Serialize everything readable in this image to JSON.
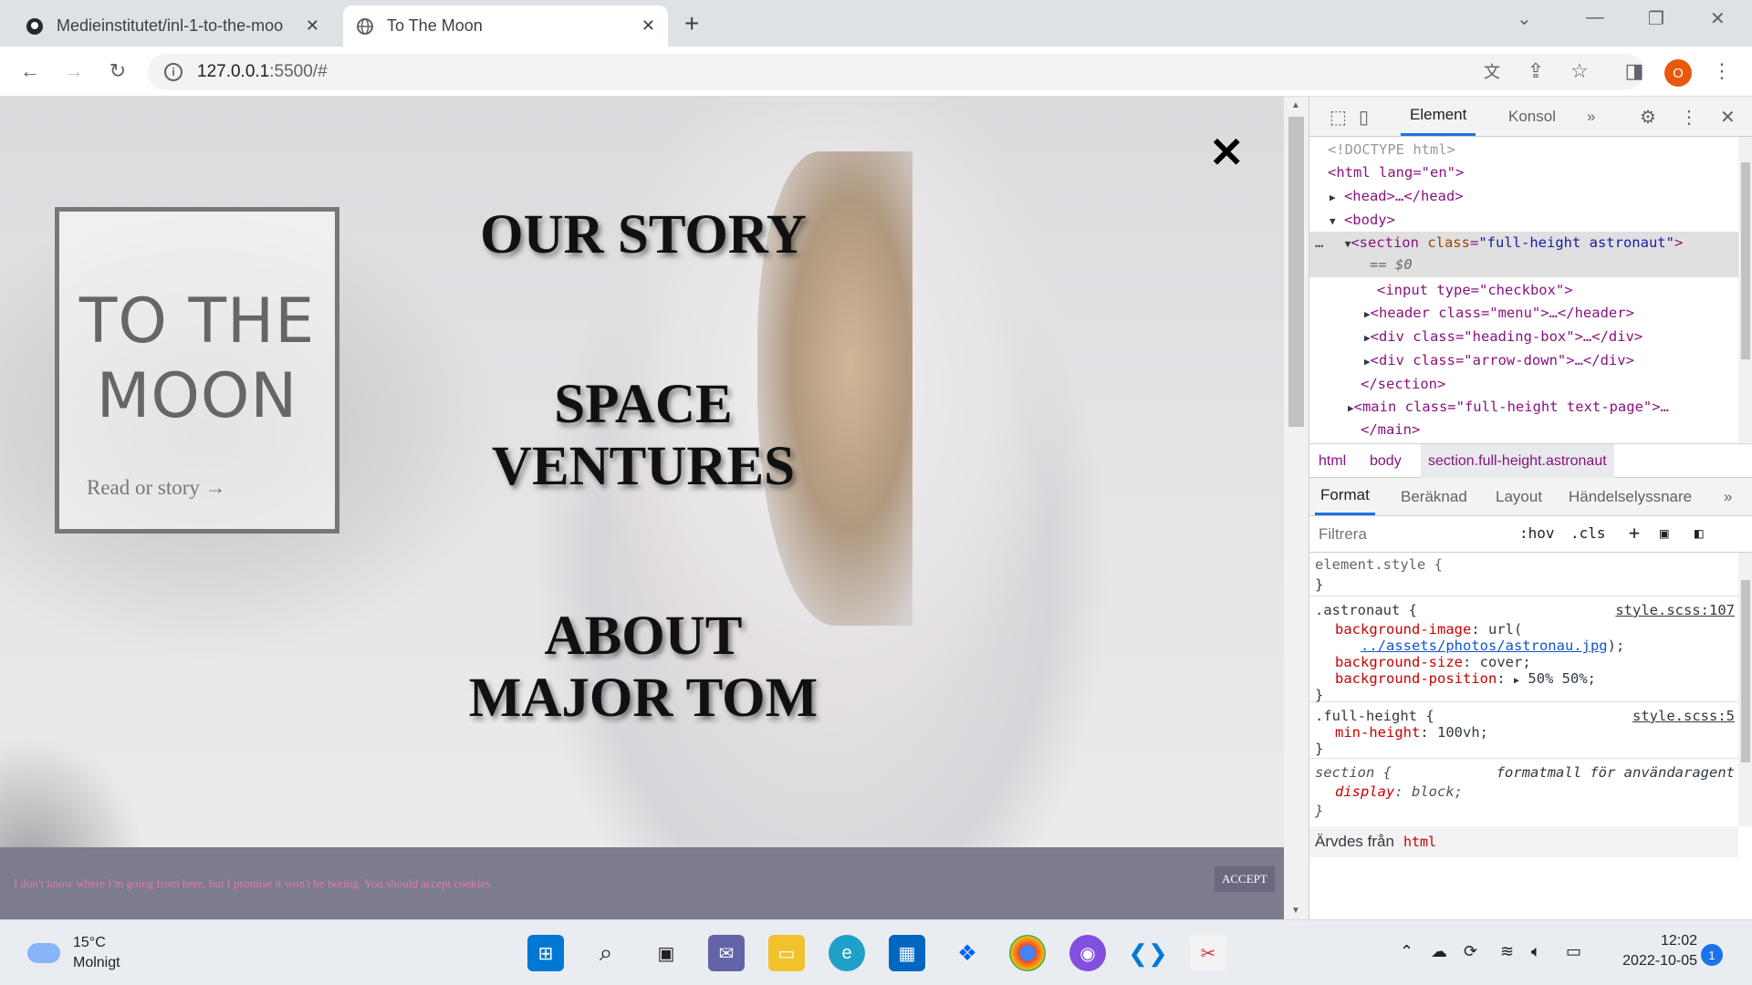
{
  "browser": {
    "tabs": [
      {
        "title": "Medieinstitutet/inl-1-to-the-moo",
        "icon": "github-icon"
      },
      {
        "title": "To The Moon",
        "icon": "globe-icon"
      }
    ],
    "url_host": "127.0.0.1",
    "url_path": ":5500/#",
    "profile_initial": "O"
  },
  "page": {
    "close_symbol": "✕",
    "logo_title_line1": "TO THE",
    "logo_title_line2": "MOON",
    "logo_link": "Read or story →",
    "menu": [
      "OUR STORY",
      "SPACE VENTURES",
      "ABOUT MAJOR TOM"
    ],
    "menu_lines": {
      "item1": "OUR STORY",
      "item2_a": "SPACE",
      "item2_b": "VENTURES",
      "item3_a": "ABOUT",
      "item3_b": "MAJOR TOM"
    },
    "cookie_text": "I don't know where I'm going from here, but I promise it won't be boring. You should accept cookies.",
    "cookie_button": "ACCEPT"
  },
  "devtools": {
    "tabs": [
      "Element",
      "Konsol"
    ],
    "more_tabs": "»",
    "dom": {
      "doctype": "<!DOCTYPE html>",
      "html_open": "<html lang=\"en\">",
      "head": "<head>…</head>",
      "body_open": "<body>",
      "section_tag": "<section",
      "section_attr": "class",
      "section_val": "\"full-height astronaut\"",
      "section_end": ">",
      "eq": "== $0",
      "input_line": "<input type=\"checkbox\">",
      "header_line": "<header class=\"menu\">…</header>",
      "div1_line": "<div class=\"heading-box\">…</div>",
      "div2_line": "<div class=\"arrow-down\">…</div>",
      "section_close": "</section>",
      "main_line": "<main class=\"full-height text-page\">…",
      "main_close": "</main>"
    },
    "breadcrumbs": [
      "html",
      "body",
      "section.full-height.astronaut"
    ],
    "style_tabs": [
      "Format",
      "Beräknad",
      "Layout",
      "Händelselyssnare"
    ],
    "filter_placeholder": "Filtrera",
    "filter_tools": [
      ":hov",
      ".cls",
      "+"
    ],
    "rules": {
      "element_style": "element.style {",
      "close": "}",
      "astronaut_sel": ".astronaut {",
      "astronaut_src": "style.scss:107",
      "bg_image_prop": "background-image",
      "bg_image_val": "url(",
      "bg_image_link": "../assets/photos/astronau.jpg",
      "bg_image_end": ");",
      "bg_size_prop": "background-size",
      "bg_size_val": "cover;",
      "bg_pos_prop": "background-position",
      "bg_pos_val": "50% 50%;",
      "fh_sel": ".full-height {",
      "fh_src": "style.scss:5",
      "min_h_prop": "min-height",
      "min_h_val": "100vh;",
      "section_sel": "section {",
      "section_src": "formatmall för användaragent",
      "display_prop": "display",
      "display_val": "block;"
    },
    "inherited_label": "Ärvdes från",
    "inherited_tag": "html"
  },
  "taskbar": {
    "temp": "15°C",
    "condition": "Molnigt",
    "time": "12:02",
    "date": "2022-10-05",
    "notifications": "1"
  }
}
